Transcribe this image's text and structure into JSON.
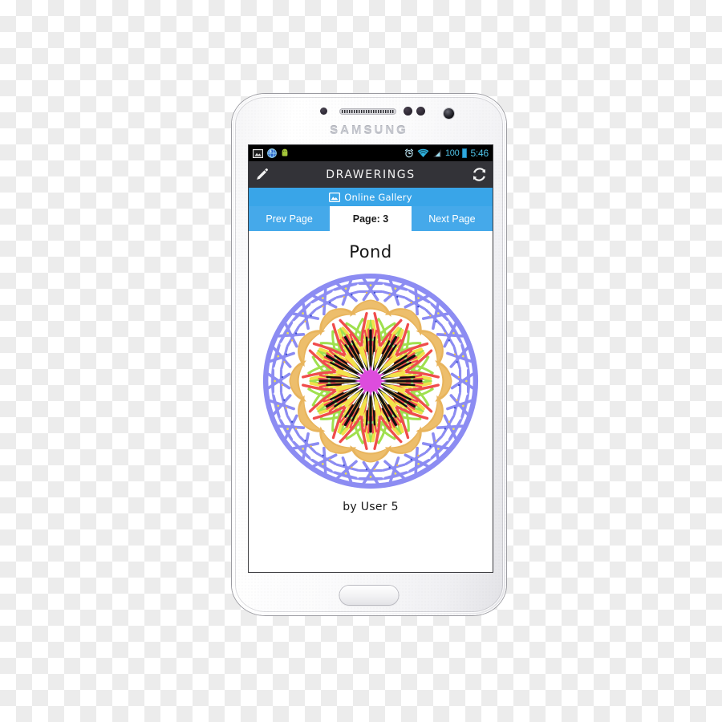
{
  "device": {
    "brand_label": "SAMSUNG",
    "home_button_name": "home-button"
  },
  "status_bar": {
    "left_icons": [
      "image-icon",
      "browser-globe-icon",
      "android-icon"
    ],
    "alarm_icon": "alarm-clock-icon",
    "wifi_icon": "wifi-icon",
    "signal_icon": "cellular-signal-icon",
    "battery_percent": "100",
    "battery_icon": "battery-full-icon",
    "time": "5:46"
  },
  "action_bar": {
    "edit_icon": "pencil-edit-icon",
    "title": "DRAWERINGS",
    "refresh_icon": "refresh-sync-icon"
  },
  "gallery_bar": {
    "icon": "image-gallery-icon",
    "label": "Online Gallery",
    "background_color": "#39a5e8"
  },
  "pager": {
    "prev_label": "Prev Page",
    "page_label": "Page: 3",
    "next_label": "Next Page",
    "active_color": "#45a9ea",
    "indicator_bg": "#ffffff"
  },
  "drawing": {
    "title": "Pond",
    "author": "by User 5",
    "symmetry": 12,
    "colors": {
      "outer_ring": "#8c8cf2",
      "crescent": "#e8b45c",
      "leaf": "#9fe04e",
      "petal_red": "#f04c4c",
      "petal_yellow": "#f2e24a",
      "spoke_black": "#111111",
      "center": "#dd4cdd"
    }
  }
}
